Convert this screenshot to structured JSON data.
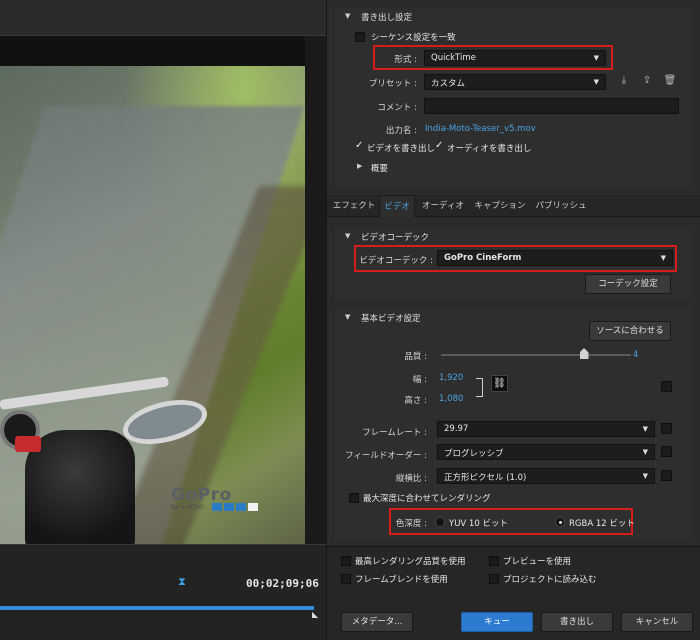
{
  "preview": {
    "timecode": "00;02;09;06",
    "progress_fraction": 1.0,
    "logo_text": "GoPro",
    "logo_sub": "Be a HERO."
  },
  "export_settings": {
    "header": "書き出し設定",
    "match_sequence_label": "シーケンス設定を一致",
    "format_label": "形式 :",
    "format_value": "QuickTime",
    "preset_label": "プリセット :",
    "preset_value": "カスタム",
    "comment_label": "コメント :",
    "comment_value": "",
    "output_name_label": "出力名 :",
    "output_name_value": "India-Moto-Teaser_v5.mov",
    "export_video_label": "ビデオを書き出し",
    "export_audio_label": "オーディオを書き出し",
    "summary_label": "概要"
  },
  "tabs": [
    {
      "label": "エフェクト"
    },
    {
      "label": "ビデオ"
    },
    {
      "label": "オーディオ"
    },
    {
      "label": "キャプション"
    },
    {
      "label": "パブリッシュ"
    }
  ],
  "video_codec": {
    "header": "ビデオコーデック",
    "codec_label": "ビデオコーデック :",
    "codec_value": "GoPro CineForm",
    "codec_settings_button": "コーデック設定"
  },
  "basic_video": {
    "header": "基本ビデオ設定",
    "match_source_button": "ソースに合わせる",
    "quality_label": "品質 :",
    "quality_value": "4",
    "quality_fraction": 0.75,
    "width_label": "幅 :",
    "width_value": "1,920",
    "height_label": "高さ :",
    "height_value": "1,080",
    "frame_rate_label": "フレームレート :",
    "frame_rate_value": "29.97",
    "field_order_label": "フィールドオーダー :",
    "field_order_value": "プログレッシブ",
    "aspect_label": "縦横比 :",
    "aspect_value": "正方形ピクセル (1.0)",
    "max_depth_label": "最大深度に合わせてレンダリング",
    "depth_label": "色深度 :",
    "depth_option_1": "YUV 10 ビット",
    "depth_option_2": "RGBA 12 ビット"
  },
  "bottom": {
    "max_quality_label": "最高レンダリング品質を使用",
    "use_preview_label": "プレビューを使用",
    "frame_blend_label": "フレームブレンドを使用",
    "import_project_label": "プロジェクトに読み込む",
    "metadata_button": "メタデータ...",
    "queue_button": "キュー",
    "export_button": "書き出し",
    "cancel_button": "キャンセル"
  },
  "colors": {
    "accent_blue": "#2d7bd1",
    "highlight_red": "#d81b1b",
    "link_blue": "#4ba3e3"
  }
}
